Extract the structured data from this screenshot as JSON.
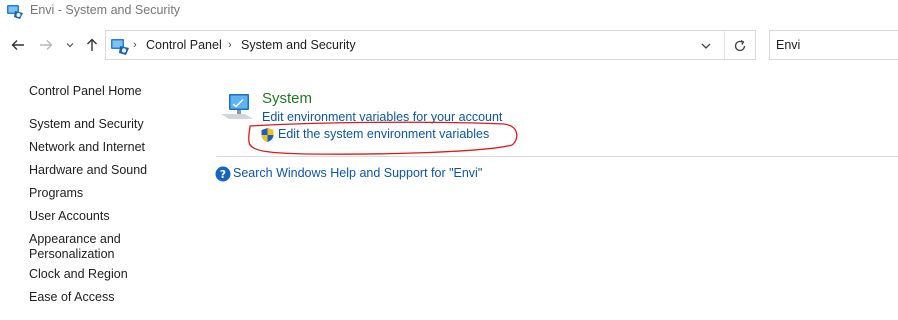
{
  "window": {
    "title": "Envi - System and Security"
  },
  "navigation": {
    "breadcrumbs": [
      "Control Panel",
      "System and Security"
    ],
    "search_value": "Envi"
  },
  "sidebar": {
    "items": [
      {
        "label": "Control Panel Home"
      },
      {
        "label": "System and Security"
      },
      {
        "label": "Network and Internet"
      },
      {
        "label": "Hardware and Sound"
      },
      {
        "label": "Programs"
      },
      {
        "label": "User Accounts"
      },
      {
        "label": "Appearance and"
      },
      {
        "label": "Personalization"
      },
      {
        "label": "Clock and Region"
      },
      {
        "label": "Ease of Access"
      }
    ]
  },
  "results": {
    "category_title": "System",
    "link_user_env": "Edit environment variables for your account",
    "link_system_env": "Edit the system environment variables",
    "help_link": "Search Windows Help and Support for \"Envi\""
  },
  "colors": {
    "category_green": "#1f7a1f",
    "link_blue": "#0b56a8",
    "annotation_red": "#e0191b"
  }
}
